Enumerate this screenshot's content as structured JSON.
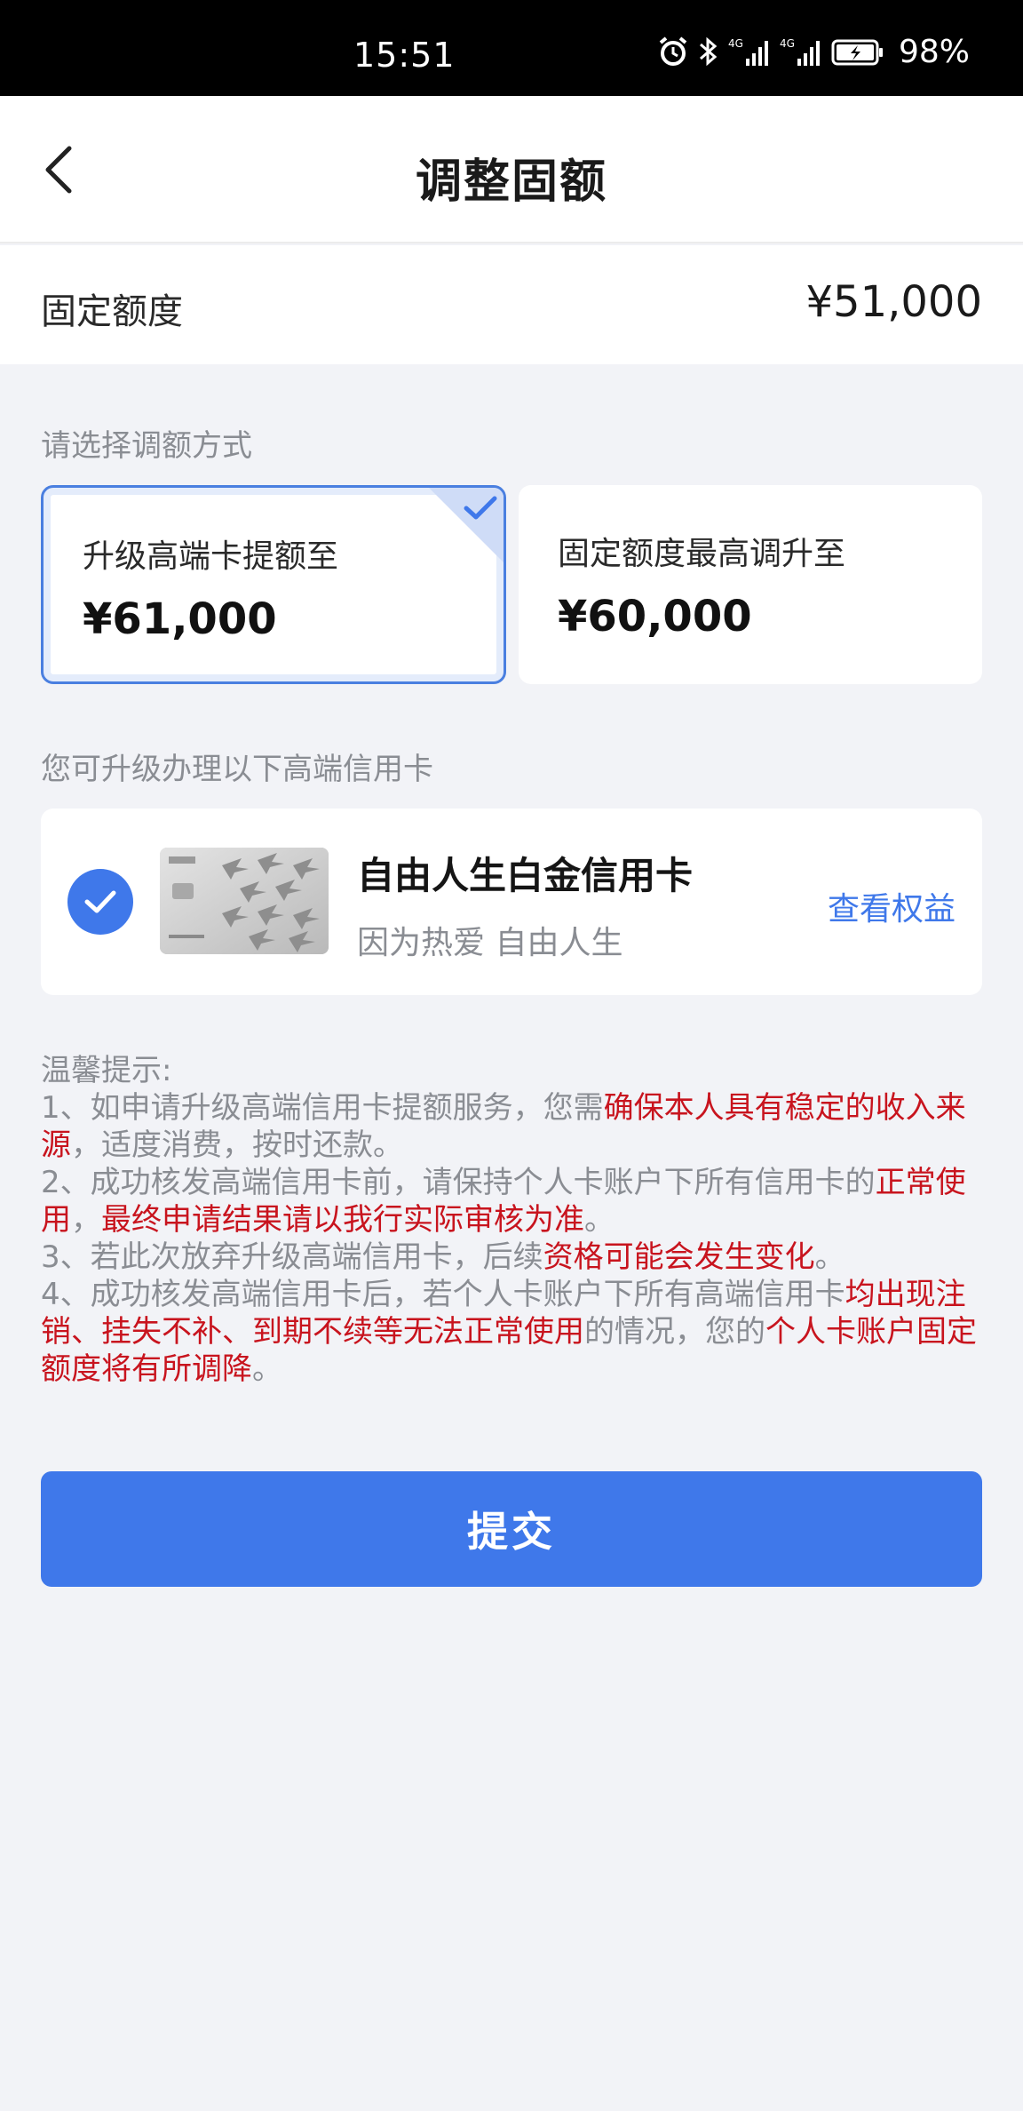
{
  "status_bar": {
    "time": "15:51",
    "battery_percent": "98%",
    "icons": [
      "alarm-icon",
      "bluetooth-icon",
      "signal-4g-icon",
      "signal-4g-icon",
      "battery-charging-icon"
    ]
  },
  "header": {
    "title": "调整固额",
    "back_icon": "chevron-left-icon"
  },
  "limit": {
    "label": "固定额度",
    "value": "¥51,000"
  },
  "method": {
    "section_label": "请选择调额方式",
    "options": [
      {
        "label": "升级高端卡提额至",
        "amount": "¥61,000",
        "selected": true
      },
      {
        "label": "固定额度最高调升至",
        "amount": "¥60,000",
        "selected": false
      }
    ]
  },
  "cards": {
    "section_label": "您可升级办理以下高端信用卡",
    "items": [
      {
        "name": "自由人生白金信用卡",
        "slogan": "因为热爱 自由人生",
        "benefits_link": "查看权益",
        "checked": true
      }
    ]
  },
  "tips": {
    "title": "温馨提示:",
    "items": [
      [
        {
          "text": "1、如申请升级高端信用卡提额服务，您需",
          "highlight": false
        },
        {
          "text": "确保本人具有稳定的收入来源",
          "highlight": true
        },
        {
          "text": "，适度消费，按时还款。",
          "highlight": false
        }
      ],
      [
        {
          "text": "2、成功核发高端信用卡前，请保持个人卡账户下所有信用卡的",
          "highlight": false
        },
        {
          "text": "正常使用",
          "highlight": true
        },
        {
          "text": "，",
          "highlight": false
        },
        {
          "text": "最终申请结果请以我行实际审核为准",
          "highlight": true
        },
        {
          "text": "。",
          "highlight": false
        }
      ],
      [
        {
          "text": "3、若此次放弃升级高端信用卡，后续",
          "highlight": false
        },
        {
          "text": "资格可能会发生变化",
          "highlight": true
        },
        {
          "text": "。",
          "highlight": false
        }
      ],
      [
        {
          "text": "4、成功核发高端信用卡后，若个人卡账户下所有高端信用卡",
          "highlight": false
        },
        {
          "text": "均出现注销、挂失不补、到期不续等无法正常使用",
          "highlight": true
        },
        {
          "text": "的情况，您的",
          "highlight": false
        },
        {
          "text": "个人卡账户固定额度将有所调降",
          "highlight": true
        },
        {
          "text": "。",
          "highlight": false
        }
      ]
    ]
  },
  "submit": {
    "label": "提交"
  },
  "colors": {
    "accent": "#3f78ea",
    "highlight_red": "#c8141e",
    "background": "#f2f3f7"
  }
}
